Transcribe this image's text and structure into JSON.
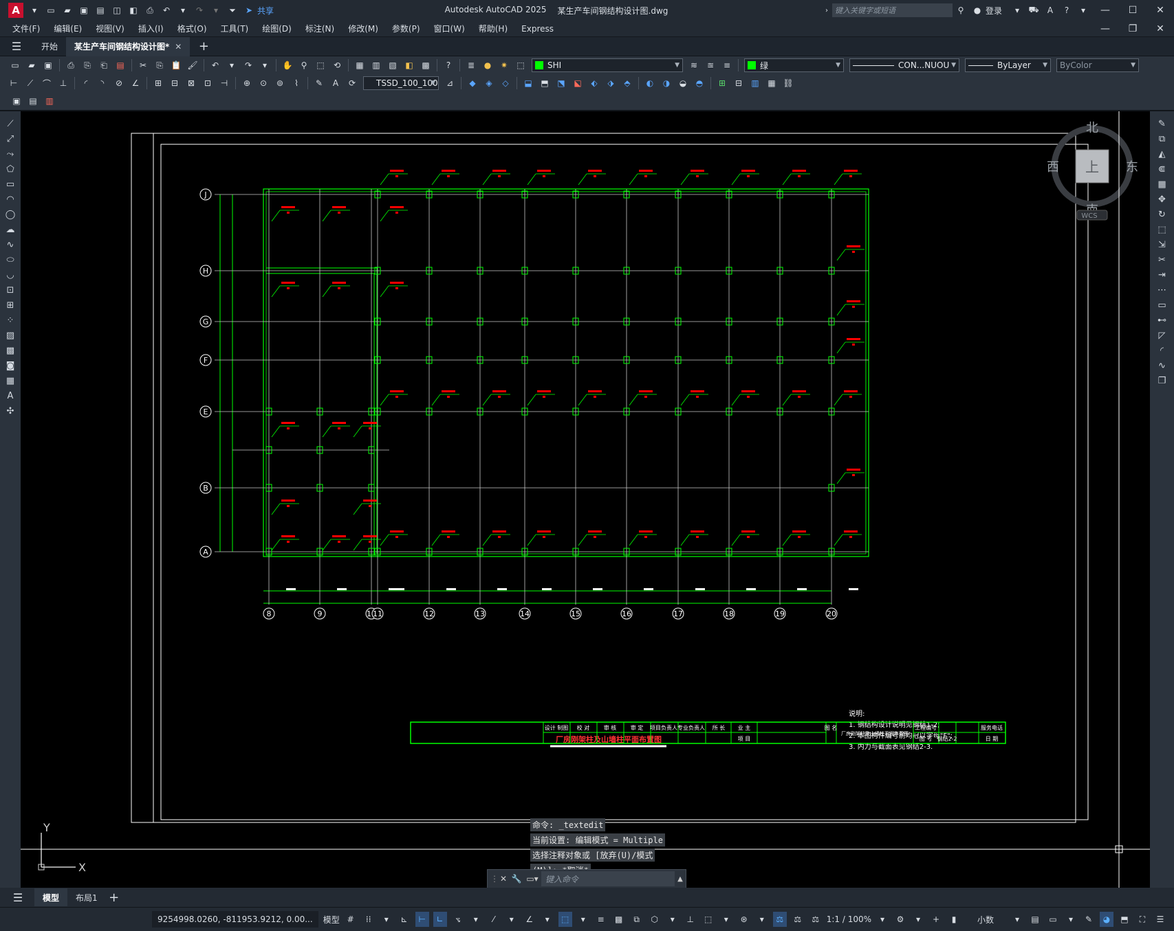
{
  "app": {
    "title": "Autodesk AutoCAD 2025",
    "file": "某生产车间钢结构设计图.dwg",
    "search_placeholder": "键入关键字或短语",
    "login": "登录",
    "share": "共享"
  },
  "menu": [
    "文件(F)",
    "编辑(E)",
    "视图(V)",
    "插入(I)",
    "格式(O)",
    "工具(T)",
    "绘图(D)",
    "标注(N)",
    "修改(M)",
    "参数(P)",
    "窗口(W)",
    "帮助(H)",
    "Express"
  ],
  "tabs": {
    "start": "开始",
    "doc": "某生产车间钢结构设计图*"
  },
  "toolbar": {
    "layer": "SHI",
    "color": "绿",
    "linetype": "CON...NUOU",
    "lineweight": "ByLayer",
    "plotstyle": "ByColor",
    "dimstyle": "TSSD_100_100"
  },
  "viewcube": {
    "north": "北",
    "south": "南",
    "east": "东",
    "west": "西",
    "top": "上",
    "wcs": "WCS"
  },
  "drawing": {
    "axes_rows": [
      "J",
      "H",
      "G",
      "F",
      "E",
      "B",
      "A"
    ],
    "axes_cols": [
      "8",
      "9",
      "10",
      "11",
      "12",
      "13",
      "14",
      "15",
      "16",
      "17",
      "18",
      "19",
      "20"
    ],
    "title": "厂房刚架柱及山墙柱平面布置图",
    "notes_title": "说明:",
    "notes": [
      "1. 钢结构设计说明见钢结1-2;",
      "2. 本图构件编号前均冠以字母\"F\";",
      "3. 内力与截面表见钢结2-3."
    ],
    "titleblock": {
      "roles": [
        "设计 制图",
        "校 对",
        "审 核",
        "审 定",
        "项目负责人",
        "专业负责人",
        "所 长",
        "业 主"
      ],
      "project_label": "项 目",
      "figname_label": "图 名",
      "figname": "厂房刚架柱及山墙柱平面布置图",
      "job_no_label": "工程编号",
      "service_label": "服务电话",
      "sheet_label": "图 号",
      "sheet_no": "钢结2-2",
      "date_label": "日 期"
    }
  },
  "command": {
    "line1": "命令: _textedit",
    "line2": "当前设置: 编辑模式 = Multiple",
    "line3": "选择注释对象或 [放弃(U)/模式",
    "line4": "(M)]: *取消*",
    "placeholder": "键入命令"
  },
  "layouts": {
    "model": "模型",
    "layout1": "布局1"
  },
  "status": {
    "coords": "9254998.0260, -811953.9212, 0.00...",
    "model": "模型",
    "scale": "1:1 / 100%",
    "units": "小数"
  },
  "colors": {
    "grid_green": "#00ff00",
    "annotation_red": "#ff0000",
    "axis_gray": "#c8c8c8"
  }
}
